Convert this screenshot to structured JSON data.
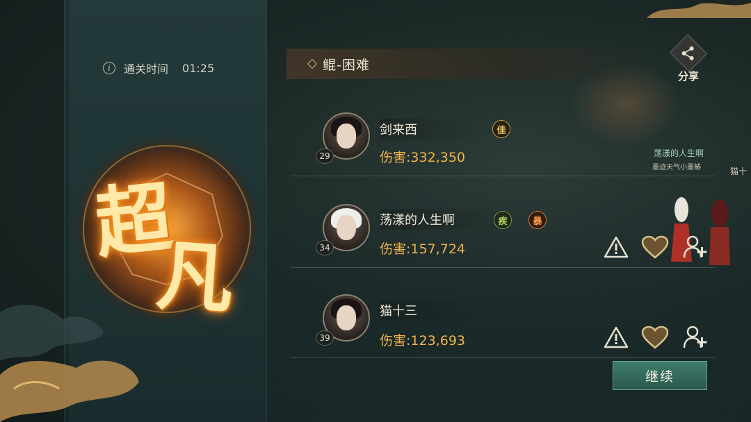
{
  "clear_time": {
    "label": "通关时间",
    "value": "01:25"
  },
  "rank": {
    "char1": "超",
    "char2": "凡"
  },
  "stage": {
    "name": "鲲-困难"
  },
  "share": {
    "label": "分享"
  },
  "players": [
    {
      "name": "剑来西",
      "level": "29",
      "damage_label": "伤害",
      "damage": "332,350",
      "badges": [
        "佳"
      ],
      "avatar_style": "dark",
      "actions": false
    },
    {
      "name": "荡漾的人生啊",
      "level": "34",
      "damage_label": "伤害",
      "damage": "157,724",
      "badges": [
        "疾",
        "暴"
      ],
      "avatar_style": "white",
      "actions": true
    },
    {
      "name": "猫十三",
      "level": "39",
      "damage_label": "伤害",
      "damage": "123,693",
      "badges": [],
      "avatar_style": "dark",
      "actions": true
    }
  ],
  "scene_labels": {
    "npc_name": "荡漾的人生啊",
    "npc_title": "墨迹天气小墨蜷",
    "npc_partial": "猫十"
  },
  "continue_button": {
    "label": "继续"
  },
  "colors": {
    "accent_gold": "#f2b34a",
    "button_teal": "#2f6457",
    "rank_glow": "#ff9c2a"
  },
  "icons": [
    "info-icon",
    "share-icon",
    "report-icon",
    "like-icon",
    "add-friend-icon"
  ]
}
